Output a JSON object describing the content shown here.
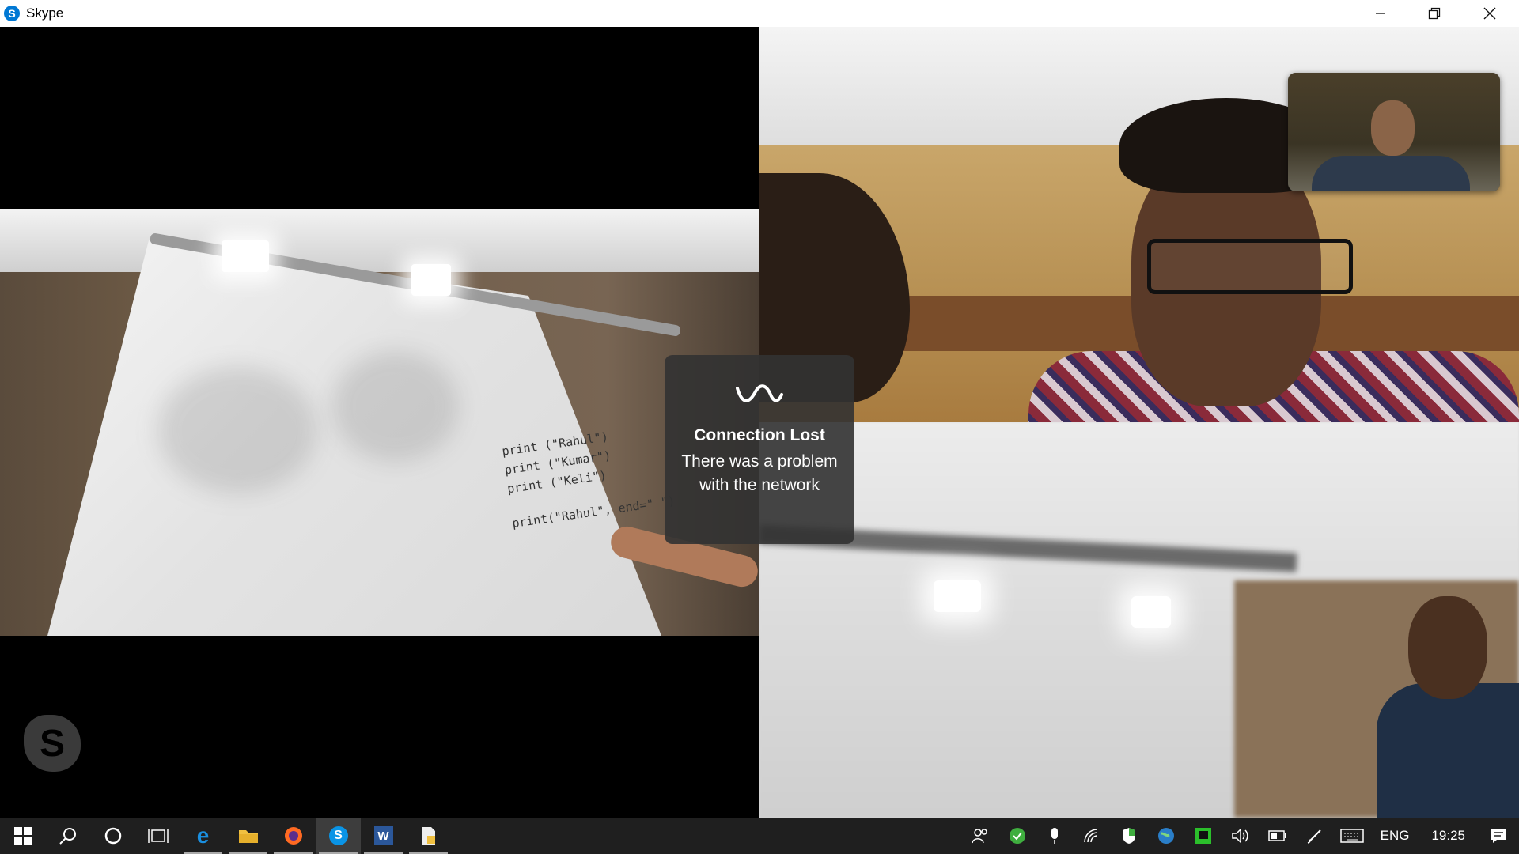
{
  "window": {
    "title": "Skype",
    "app_icon_letter": "S",
    "controls": [
      "minimize-icon",
      "restore-icon",
      "close-icon"
    ]
  },
  "call": {
    "watermark_letter": "S",
    "whiteboard_lines": [
      "print (\"Rahul\")",
      "print (\"Kumar\")",
      "print (\"Keli\")",
      "print(\"Rahul\", end=\" \")"
    ],
    "toast": {
      "icon": "connection-wave-icon",
      "title": "Connection Lost",
      "message": "There was a problem with the network"
    }
  },
  "taskbar": {
    "apps": [
      {
        "name": "start",
        "icon": "windows-start-icon"
      },
      {
        "name": "search",
        "icon": "search-icon"
      },
      {
        "name": "cortana",
        "icon": "cortana-icon"
      },
      {
        "name": "task-view",
        "icon": "task-view-icon"
      },
      {
        "name": "edge",
        "icon": "edge-icon",
        "letter": "e",
        "color": "#1a8fe0"
      },
      {
        "name": "file-explorer",
        "icon": "folder-icon",
        "color": "#f0c040"
      },
      {
        "name": "firefox",
        "icon": "firefox-icon",
        "color": "#ff6a22"
      },
      {
        "name": "skype",
        "icon": "skype-icon",
        "letter": "S",
        "color": "#0a94e6"
      },
      {
        "name": "word",
        "icon": "word-icon",
        "letter": "W",
        "color": "#2b579a"
      },
      {
        "name": "document",
        "icon": "document-icon"
      }
    ],
    "tray": {
      "language": "ENG",
      "time": "19:25",
      "icons": [
        "people-icon",
        "check-shield-icon",
        "microphone-icon",
        "wifi-icon",
        "defender-shield-icon",
        "globe-icon",
        "monitor-icon",
        "volume-icon",
        "battery-icon",
        "pen-icon",
        "keyboard-icon"
      ]
    }
  }
}
